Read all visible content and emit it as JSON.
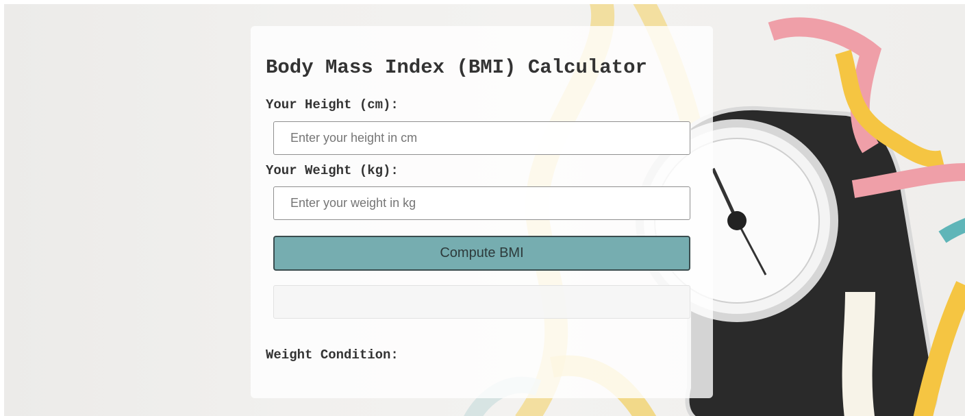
{
  "app": {
    "title": "Body Mass Index (BMI) Calculator"
  },
  "form": {
    "height_label": "Your Height (cm):",
    "height_value": "",
    "height_placeholder": "Enter your height in cm",
    "weight_label": "Your Weight (kg):",
    "weight_value": "",
    "weight_placeholder": "Enter your weight in kg",
    "compute_label": "Compute BMI",
    "result_value": "",
    "condition_label": "Weight Condition:"
  },
  "colors": {
    "button": "#76adb0",
    "button_border": "#3a4c4e",
    "text": "#333333"
  },
  "icons": {
    "background": "bathroom-scale-and-measuring-tape-photo"
  }
}
